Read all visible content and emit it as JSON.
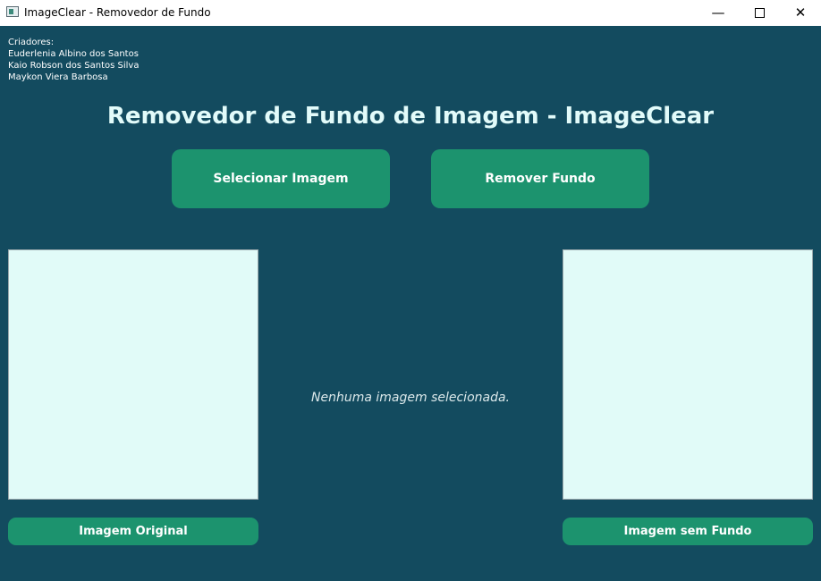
{
  "window": {
    "title": "ImageClear - Removedor de Fundo",
    "controls": {
      "minimize": "—",
      "close": "✕"
    }
  },
  "creators": {
    "heading": "Criadores:",
    "names": [
      "Euderlenia Albino dos Santos",
      "Kaio Robson dos Santos Silva",
      "Maykon Viera Barbosa"
    ]
  },
  "main": {
    "title": "Removedor de Fundo de Imagem - ImageClear",
    "select_button": "Selecionar Imagem",
    "remove_button": "Remover Fundo",
    "status": "Nenhuma imagem selecionada.",
    "original_caption": "Imagem Original",
    "result_caption": "Imagem sem Fundo"
  },
  "colors": {
    "background": "#134b5f",
    "accent": "#1c936e",
    "panel": "#e1fbf8",
    "title_text": "#e2fbfa"
  },
  "icons": [
    "app-icon",
    "minimize-icon",
    "maximize-icon",
    "close-icon"
  ]
}
